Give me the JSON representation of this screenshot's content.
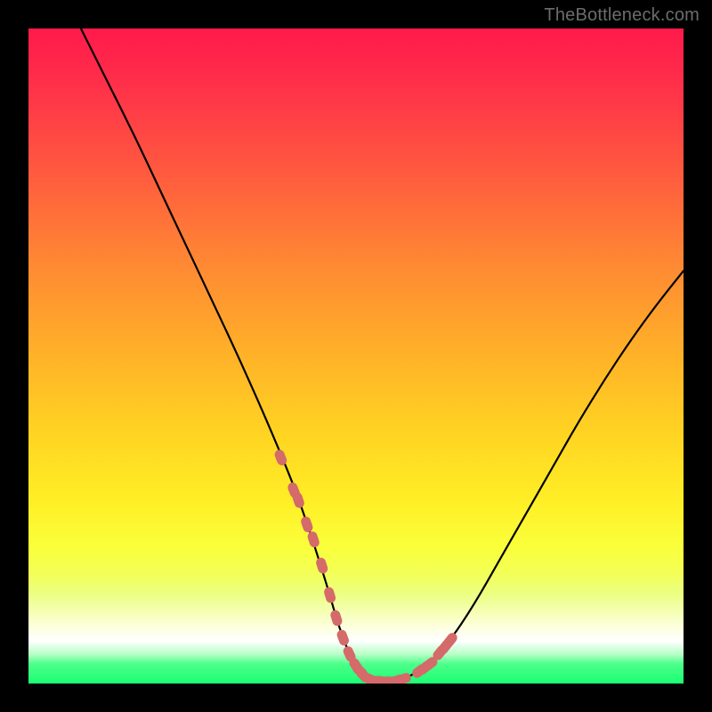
{
  "watermark": "TheBottleneck.com",
  "chart_data": {
    "type": "line",
    "title": "",
    "xlabel": "",
    "ylabel": "",
    "xlim": [
      0,
      100
    ],
    "ylim": [
      0,
      100
    ],
    "grid": false,
    "legend": false,
    "series": [
      {
        "name": "curve",
        "stroke": "#000000",
        "x": [
          8,
          12,
          16,
          20,
          24,
          28,
          32,
          36,
          40,
          42,
          44,
          46,
          47,
          48,
          49,
          50,
          51,
          52,
          53,
          55,
          57,
          60,
          64,
          68,
          72,
          76,
          80,
          84,
          88,
          92,
          96,
          100
        ],
        "y": [
          100,
          92,
          84,
          75.5,
          67,
          58.5,
          50,
          41,
          31.5,
          26,
          20,
          13.5,
          10,
          7,
          4.5,
          2.7,
          1.5,
          0.8,
          0.4,
          0.3,
          0.6,
          2,
          6,
          12,
          19,
          26,
          33,
          40,
          46.5,
          52.5,
          58,
          63
        ]
      },
      {
        "name": "markers",
        "type": "scatter",
        "stroke": "#d46a6a",
        "fill": "#d46a6a",
        "x": [
          38.5,
          40.5,
          41.2,
          42.5,
          43.5,
          44.8,
          46.0,
          47.0,
          48.0,
          49.0,
          50.0,
          50.6,
          51.2,
          51.8,
          52.4,
          53.0,
          53.8,
          54.6,
          55.4,
          56.2,
          57.2,
          59.7,
          60.5,
          61.3,
          62.8,
          63.6,
          64.4
        ],
        "y": [
          34.5,
          29.5,
          28.0,
          24.3,
          22.0,
          18.0,
          13.5,
          10.0,
          7.0,
          4.5,
          2.7,
          1.9,
          1.2,
          0.8,
          0.5,
          0.4,
          0.35,
          0.3,
          0.3,
          0.45,
          0.7,
          1.9,
          2.4,
          3.0,
          4.7,
          5.6,
          6.6
        ]
      }
    ],
    "annotations": []
  }
}
